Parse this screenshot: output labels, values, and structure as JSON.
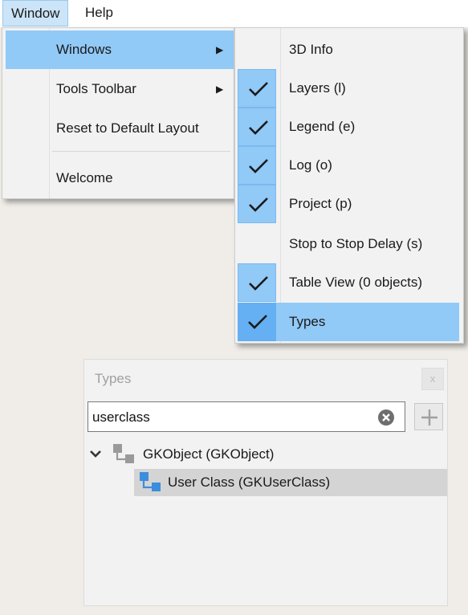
{
  "menubar": {
    "items": [
      {
        "label": "Window"
      },
      {
        "label": "Help"
      }
    ]
  },
  "window_menu": {
    "items": [
      {
        "label": "Windows",
        "submenu": true
      },
      {
        "label": "Tools Toolbar",
        "submenu": true
      },
      {
        "label": "Reset to Default Layout"
      },
      {
        "label": "Welcome"
      }
    ]
  },
  "windows_submenu": {
    "items": [
      {
        "label": "3D Info",
        "checked": false
      },
      {
        "label": "Layers (l)",
        "checked": true
      },
      {
        "label": "Legend (e)",
        "checked": true
      },
      {
        "label": "Log (o)",
        "checked": true
      },
      {
        "label": "Project (p)",
        "checked": true
      },
      {
        "label": "Stop to Stop Delay (s)",
        "checked": false
      },
      {
        "label": "Table View (0 objects)",
        "checked": true
      },
      {
        "label": "Types",
        "checked": true,
        "highlighted": true
      }
    ]
  },
  "types_panel": {
    "title": "Types",
    "close_label": "x",
    "search": {
      "value": "userclass"
    },
    "tree": [
      {
        "label": "GKObject (GKObject)",
        "expanded": true,
        "icon": "class-hierarchy-icon"
      },
      {
        "label": "User Class (GKUserClass)",
        "selected": true,
        "icon": "class-hierarchy-icon"
      }
    ]
  },
  "colors": {
    "menu_highlight": "#91c9f7",
    "check_highlight": "#64b0f2",
    "selected_row": "#d4d4d4"
  }
}
